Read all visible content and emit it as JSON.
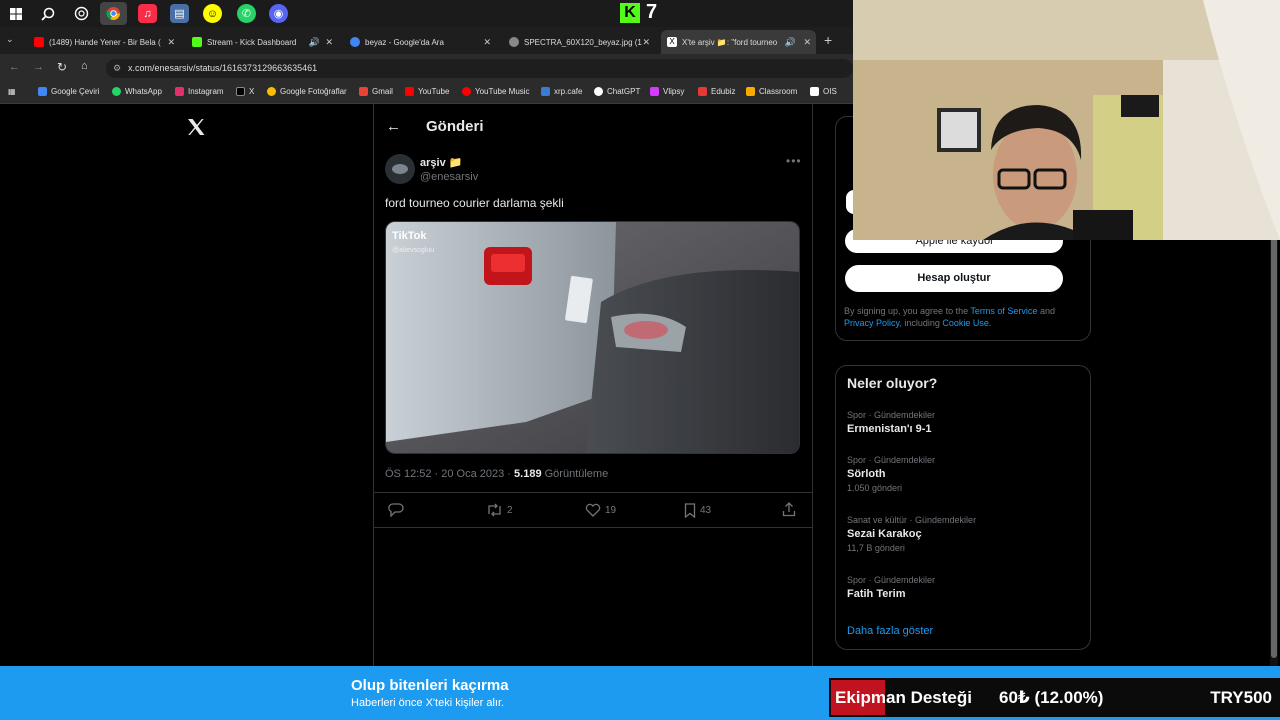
{
  "taskbar": {
    "apps": [
      "windows-start",
      "search",
      "chatgpt",
      "chrome",
      "itunes",
      "network",
      "snapchat",
      "whatsapp",
      "discord"
    ],
    "kick_count": "7"
  },
  "tabs": [
    {
      "label": "(1489) Hande Yener - Bir Bela (",
      "color": "#ff0000"
    },
    {
      "label": "Stream - Kick Dashboard",
      "color": "#53fc18"
    },
    {
      "label": "beyaz - Google'da Ara",
      "color": "#4285f4"
    },
    {
      "label": "SPECTRA_60X120_beyaz.jpg (1",
      "color": "#888888"
    },
    {
      "label": "X'te arşiv 📁: \"ford tourneo",
      "color": "#ffffff"
    }
  ],
  "address": {
    "url": "x.com/enesarsiv/status/1616373129663635461"
  },
  "bookmarks": [
    "Google Çeviri",
    "WhatsApp",
    "Instagram",
    "X",
    "Google Fotoğraflar",
    "Gmail",
    "YouTube",
    "YouTube Music",
    "xrp.cafe",
    "ChatGPT",
    "Vlipsy",
    "Edubiz",
    "Classroom",
    "OIS"
  ],
  "post": {
    "header_title": "Gönderi",
    "author_name": "arşiv 📁",
    "author_handle": "@enesarsiv",
    "text": "ford tourneo courier darlama şekli",
    "video_watermark": "TikTok",
    "video_handle": "@alievsogluu",
    "timestamp": "ÖS 12:52 · 20 Oca 2023 · ",
    "views_count": "5.189",
    "views_label": " Görüntüleme",
    "reposts": "2",
    "likes": "19",
    "bookmarks": "43"
  },
  "signup": {
    "apple_label": "Apple ile kaydol",
    "create_label": "Hesap oluştur",
    "legal_prefix": "By signing up, you agree to the ",
    "terms": "Terms of Service",
    "and": " and",
    "privacy": "Privacy Policy",
    "including": ", including ",
    "cookie": "Cookie Use."
  },
  "trends": {
    "title": "Neler oluyor?",
    "items": [
      {
        "category": "Spor · Gündemdekiler",
        "title": "Ermenistan'ı 9-1",
        "count": ""
      },
      {
        "category": "Spor · Gündemdekiler",
        "title": "Sörloth",
        "count": "1.050 gönderi"
      },
      {
        "category": "Sanat ve kültür · Gündemdekiler",
        "title": "Sezai Karakoç",
        "count": "11,7 B gönderi"
      },
      {
        "category": "Spor · Gündemdekiler",
        "title": "Fatih Terim",
        "count": ""
      }
    ],
    "show_more": "Daha fazla göster"
  },
  "banner": {
    "title": "Olup bitenleri kaçırma",
    "subtitle": "Haberleri önce X'teki kişiler alır."
  },
  "donation": {
    "label": "Ekipman Desteği",
    "progress": "60₺ (12.00%)",
    "progress_fraction": 0.12,
    "goal": "TRY500"
  }
}
